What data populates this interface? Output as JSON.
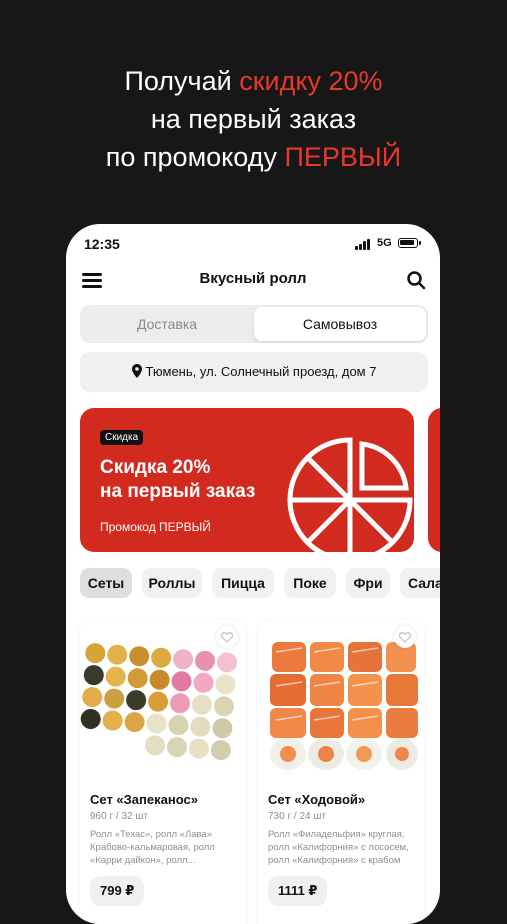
{
  "promo": {
    "line1_pre": "Получай ",
    "line1_accent": "скидку 20%",
    "line2": "на первый заказ",
    "line3_pre": "по промокоду ",
    "line3_accent": "ПЕРВЫЙ"
  },
  "status": {
    "time": "12:35",
    "network": "5G"
  },
  "app": {
    "title": "Вкусный ролл"
  },
  "delivery_tabs": {
    "delivery": "Доставка",
    "pickup": "Самовывоз",
    "selected": "Самовывоз"
  },
  "address": "Тюмень, ул. Солнечный проезд, дом 7",
  "banner": {
    "badge": "Скидка",
    "title_line1": "Скидка 20%",
    "title_line2": "на первый заказ",
    "subtitle": "Промокод ПЕРВЫЙ"
  },
  "categories": [
    "Сеты",
    "Роллы",
    "Пицца",
    "Поке",
    "Фри",
    "Сала"
  ],
  "active_category": "Сеты",
  "products": [
    {
      "name": "Сет «Запеканос»",
      "meta": "960 г / 32 шт",
      "desc": "Ролл «Техас», ролл «Лава» Крабово-кальмаровая, ролл «Карри дайкон», ролл...",
      "price": "799 ₽"
    },
    {
      "name": "Сет «Ходовой»",
      "meta": "730 г / 24 шт",
      "desc": "Ролл «Филадельфия» круглая, ролл «Калифорния» с лососем, ролл «Калифорния» с крабом",
      "price": "1111 ₽"
    }
  ],
  "colors": {
    "accent": "#e8382b",
    "banner": "#d22a1e",
    "background": "#171717"
  }
}
